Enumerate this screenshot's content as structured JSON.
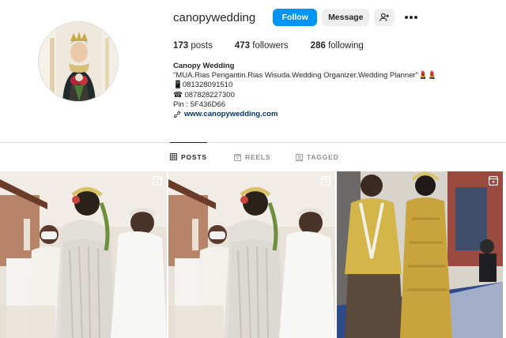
{
  "profile": {
    "username": "canopywedding",
    "follow_label": "Follow",
    "message_label": "Message",
    "add_user_icon": "add-user-icon",
    "more_icon": "more-options-icon",
    "avatar_icon": "profile-photo"
  },
  "stats": {
    "posts_count": "173",
    "posts_label": "posts",
    "followers_count": "473",
    "followers_label": "followers",
    "following_count": "286",
    "following_label": "following"
  },
  "bio": {
    "name": "Canopy Wedding",
    "line1": "\"MUA.Rias Pengantin.Rias Wisuda.Wedding Organizer.Wedding Planner\"💄💄",
    "line2": "📱081328091510",
    "line3": "☎ 087828227300",
    "line4": "Pin : 5F436D66",
    "link": "www.canopywedding.com",
    "link_icon": "link-icon"
  },
  "tabs": [
    {
      "label": "POSTS",
      "icon": "grid-icon",
      "active": true
    },
    {
      "label": "REELS",
      "icon": "reels-icon",
      "active": false
    },
    {
      "label": "TAGGED",
      "icon": "tagged-icon",
      "active": false
    }
  ],
  "posts": [
    {
      "type": "reel",
      "icon": "reel-badge-icon"
    },
    {
      "type": "reel",
      "icon": "reel-badge-icon"
    },
    {
      "type": "reel",
      "icon": "reel-badge-icon"
    }
  ],
  "colors": {
    "accent": "#0095f6",
    "text": "#262626",
    "muted": "#8e8e8e",
    "link": "#00376b",
    "divider": "#dbdbdb"
  }
}
